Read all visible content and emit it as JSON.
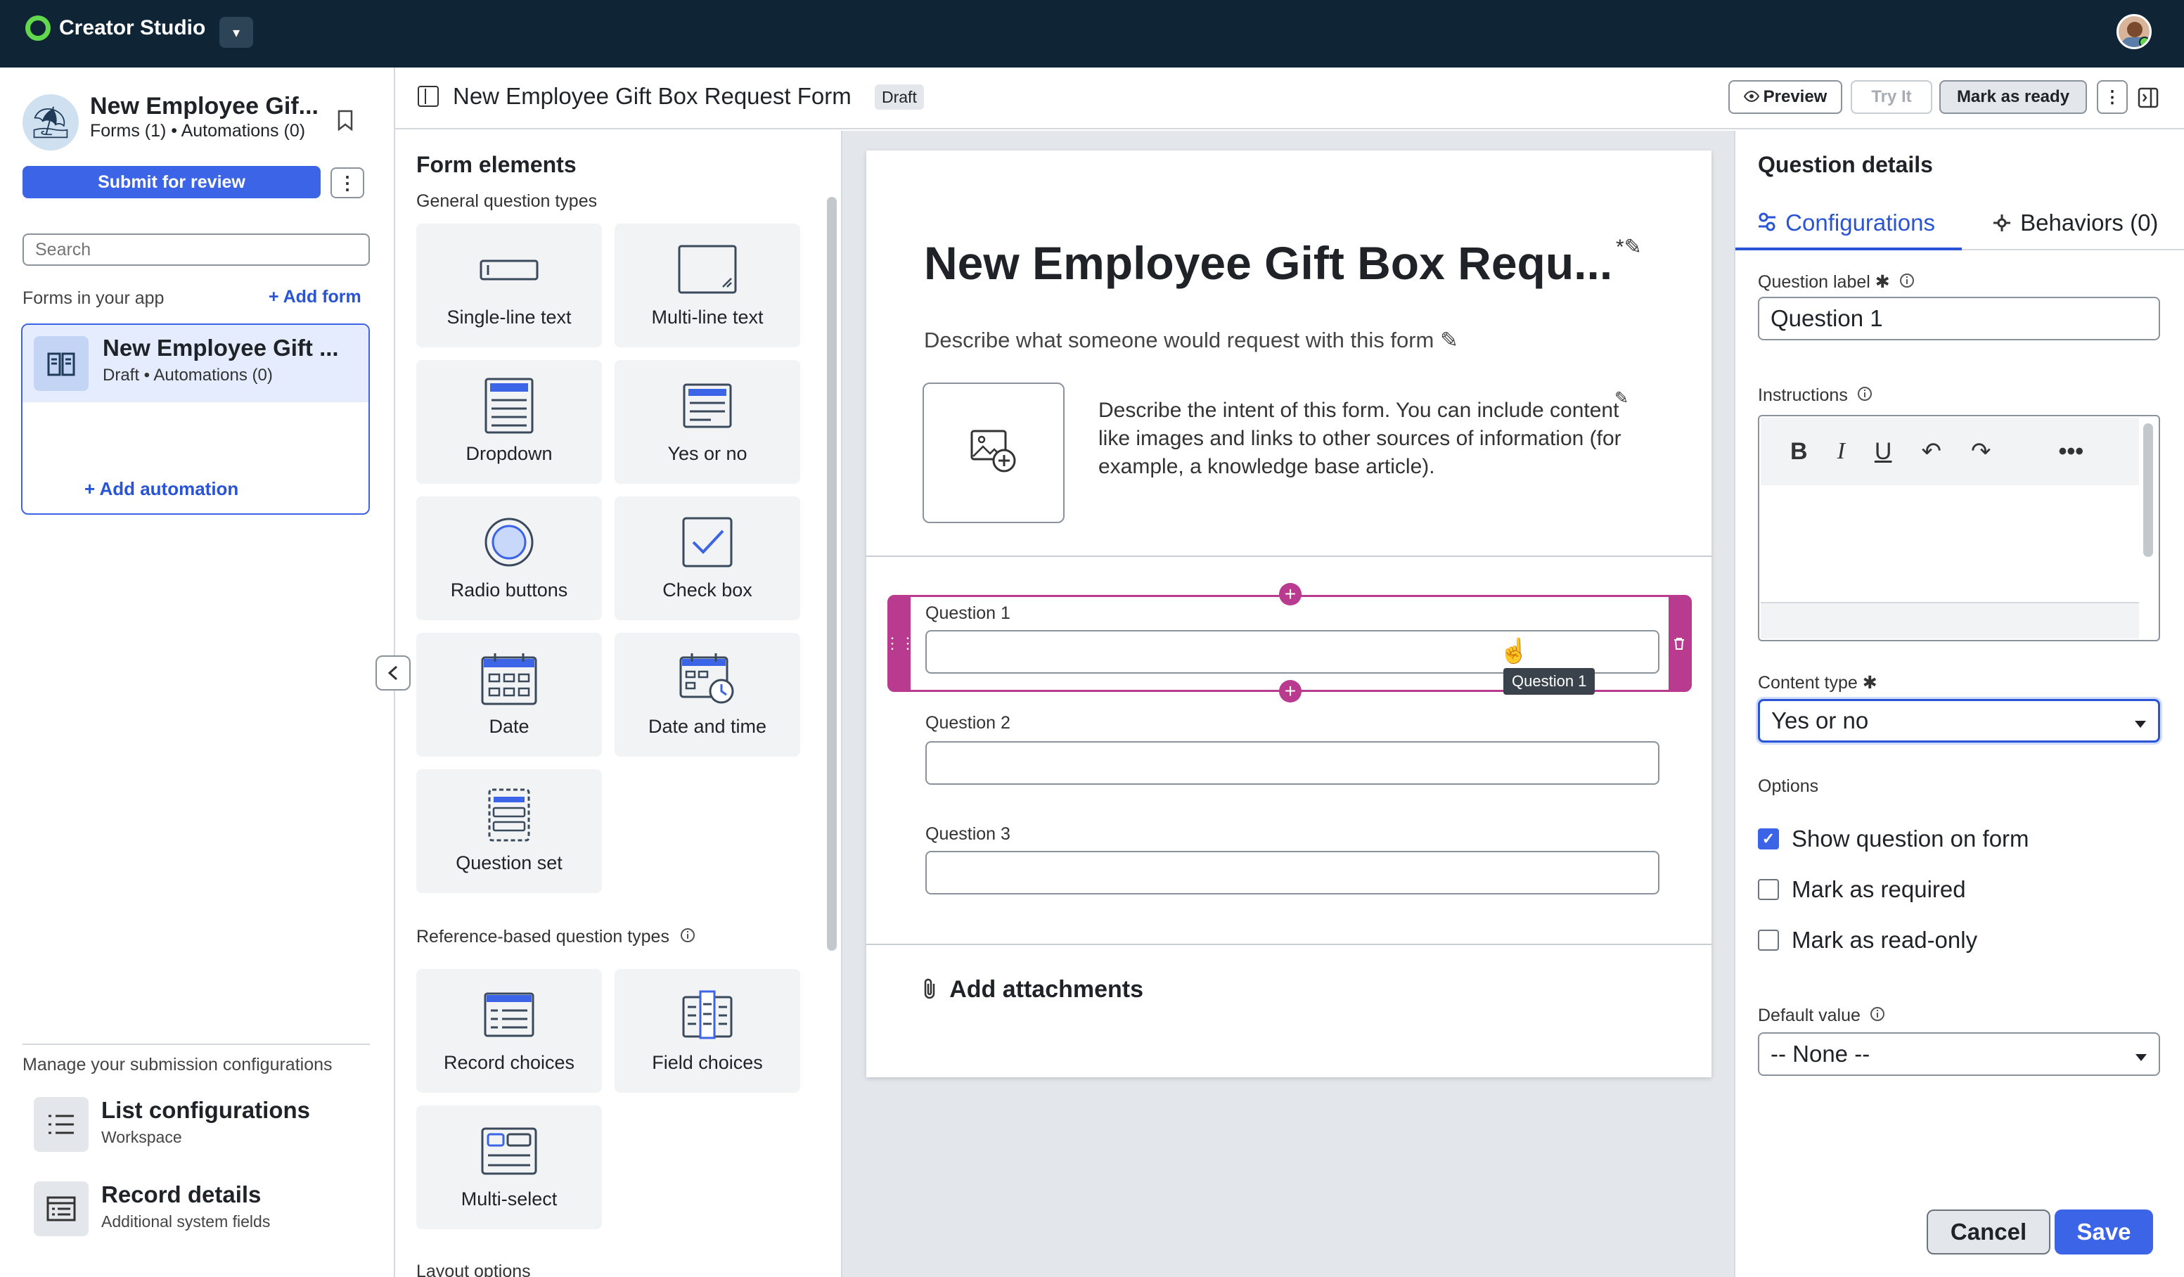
{
  "topbar": {
    "brand": "Creator Studio",
    "caret": "▾"
  },
  "sidebar": {
    "app_title": "New Employee Gif...",
    "app_sub": "Forms (1) • Automations (0)",
    "submit_label": "Submit for review",
    "kebab": "⋮",
    "search_placeholder": "Search",
    "forms_label": "Forms in your app",
    "add_form": "+ Add form",
    "form_card": {
      "title": "New Employee Gift ...",
      "sub": "Draft • Automations (0)",
      "add_automation": "+ Add automation"
    },
    "manage_label": "Manage your submission configurations",
    "nav": [
      {
        "title": "List configurations",
        "sub": "Workspace"
      },
      {
        "title": "Record details",
        "sub": "Additional system fields"
      }
    ]
  },
  "header": {
    "title": "New Employee Gift Box Request Form",
    "status": "Draft",
    "preview": "Preview",
    "try_it": "Try It",
    "mark_ready": "Mark as ready",
    "kebab": "⋮"
  },
  "palette": {
    "title": "Form elements",
    "general_label": "General question types",
    "general": [
      {
        "label": "Single-line text",
        "icon": "single-line-icon"
      },
      {
        "label": "Multi-line text",
        "icon": "multi-line-icon"
      },
      {
        "label": "Dropdown",
        "icon": "dropdown-icon"
      },
      {
        "label": "Yes or no",
        "icon": "yes-no-icon"
      },
      {
        "label": "Radio buttons",
        "icon": "radio-icon"
      },
      {
        "label": "Check box",
        "icon": "checkbox-icon"
      },
      {
        "label": "Date",
        "icon": "calendar-icon"
      },
      {
        "label": "Date and time",
        "icon": "calendar-clock-icon"
      },
      {
        "label": "Question set",
        "icon": "question-set-icon"
      }
    ],
    "ref_label": "Reference-based question types",
    "reference": [
      {
        "label": "Record choices",
        "icon": "record-choices-icon"
      },
      {
        "label": "Field choices",
        "icon": "field-choices-icon"
      },
      {
        "label": "Multi-select",
        "icon": "multi-select-icon"
      }
    ],
    "layout_label": "Layout options"
  },
  "canvas": {
    "form_title": "New Employee Gift Box Requ...",
    "title_icons": "*✎",
    "description": "Describe what someone would request with this form ✎",
    "intent": "Describe the intent of this form. You can include content like images and links to other sources of information (for example, a knowledge base article).",
    "questions": [
      {
        "label": "Question 1"
      },
      {
        "label": "Question 2"
      },
      {
        "label": "Question 3"
      }
    ],
    "tooltip": "Question 1",
    "attachments": "Add attachments"
  },
  "details": {
    "title": "Question details",
    "tab_config": "Configurations",
    "tab_behaviors": "Behaviors (0)",
    "label_label": "Question label",
    "label_value": "Question 1",
    "instructions_label": "Instructions",
    "content_type_label": "Content type",
    "content_type_value": "Yes or no",
    "options_label": "Options",
    "options": [
      {
        "label": "Show question on form",
        "checked": true
      },
      {
        "label": "Mark as required",
        "checked": false
      },
      {
        "label": "Mark as read-only",
        "checked": false
      }
    ],
    "default_label": "Default value",
    "default_value": "-- None --",
    "cancel": "Cancel",
    "save": "Save"
  },
  "colors": {
    "accent": "#3c64e6",
    "topbar": "#0f2434",
    "selection": "#b83b8f"
  }
}
